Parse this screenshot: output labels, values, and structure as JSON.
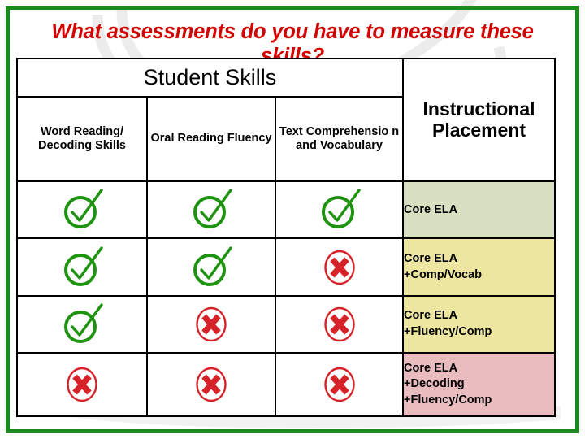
{
  "slide": {
    "title": "What assessments do you have to measure these skills?",
    "frame_color": "#1a8a1a",
    "title_color": "#d40000"
  },
  "table": {
    "banner_label": "Student Skills",
    "placement_header": "Instructional Placement",
    "skill_headers": [
      "Word Reading/ Decoding Skills",
      "Oral Reading Fluency",
      "Text Comprehensio n and Vocabulary"
    ],
    "icons": {
      "check": "green-check-circle-icon",
      "cross": "red-cross-circle-icon"
    },
    "icon_colors": {
      "check": "#1e9310",
      "cross": "#d6232a"
    },
    "rows": [
      {
        "marks": [
          "check",
          "check",
          "check"
        ],
        "placement": "Core ELA",
        "placement_bg": "#d7e0c0"
      },
      {
        "marks": [
          "check",
          "check",
          "cross"
        ],
        "placement": "Core ELA\n+Comp/Vocab",
        "placement_bg": "#ece6a0"
      },
      {
        "marks": [
          "check",
          "cross",
          "cross"
        ],
        "placement": "Core ELA\n+Fluency/Comp",
        "placement_bg": "#ece6a0"
      },
      {
        "marks": [
          "cross",
          "cross",
          "cross"
        ],
        "placement": "Core ELA\n+Decoding\n+Fluency/Comp",
        "placement_bg": "#e9bcc0"
      }
    ]
  }
}
